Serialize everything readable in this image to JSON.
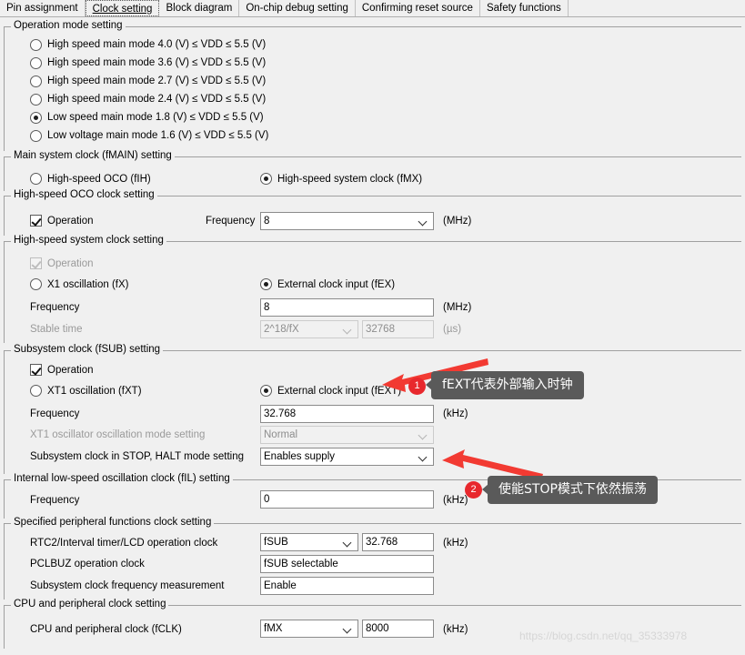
{
  "tabs": [
    {
      "label": "Pin assignment",
      "active": false
    },
    {
      "label": "Clock setting",
      "active": true
    },
    {
      "label": "Block diagram",
      "active": false
    },
    {
      "label": "On-chip debug setting",
      "active": false
    },
    {
      "label": "Confirming reset source",
      "active": false
    },
    {
      "label": "Safety functions",
      "active": false
    }
  ],
  "groups": {
    "operation_mode": {
      "title": "Operation mode setting",
      "options": [
        {
          "label": "High speed main mode 4.0 (V) ≤ VDD ≤ 5.5 (V)",
          "selected": false
        },
        {
          "label": "High speed main mode 3.6 (V) ≤ VDD ≤ 5.5 (V)",
          "selected": false
        },
        {
          "label": "High speed main mode 2.7 (V) ≤ VDD ≤ 5.5 (V)",
          "selected": false
        },
        {
          "label": "High speed main mode 2.4 (V) ≤ VDD ≤ 5.5 (V)",
          "selected": false
        },
        {
          "label": "Low speed main mode 1.8 (V) ≤ VDD ≤ 5.5 (V)",
          "selected": true
        },
        {
          "label": "Low voltage main mode 1.6 (V) ≤ VDD ≤ 5.5 (V)",
          "selected": false
        }
      ]
    },
    "main_system_clock": {
      "title": "Main system clock (fMAIN) setting",
      "option_fih": "High-speed OCO (fIH)",
      "option_fmx": "High-speed system clock (fMX)"
    },
    "hs_oco": {
      "title": "High-speed OCO clock setting",
      "operation_label": "Operation",
      "frequency_label": "Frequency",
      "frequency_value": "8",
      "unit": "(MHz)"
    },
    "hs_system": {
      "title": "High-speed system clock setting",
      "operation_label": "Operation",
      "option_fx": "X1 oscillation (fX)",
      "option_fex": "External clock input (fEX)",
      "frequency_label": "Frequency",
      "frequency_value": "8",
      "frequency_unit": "(MHz)",
      "stable_time_label": "Stable time",
      "stable_time_value": "2^18/fX",
      "stable_time_number": "32768",
      "stable_time_unit": "(µs)"
    },
    "subsystem": {
      "title": "Subsystem clock (fSUB) setting",
      "operation_label": "Operation",
      "option_fxt": "XT1 oscillation (fXT)",
      "option_fext": "External clock input (fEXT)",
      "frequency_label": "Frequency",
      "frequency_value": "32.768",
      "frequency_unit": "(kHz)",
      "xt1_mode_label": "XT1 oscillator oscillation mode setting",
      "xt1_mode_value": "Normal",
      "stop_halt_label": "Subsystem clock in STOP, HALT mode setting",
      "stop_halt_value": "Enables supply"
    },
    "internal_low_speed": {
      "title": "Internal low-speed oscillation clock (fIL) setting",
      "frequency_label": "Frequency",
      "frequency_value": "0",
      "frequency_unit": "(kHz)"
    },
    "peripheral": {
      "title": "Specified peripheral functions clock setting",
      "rtc_label": "RTC2/Interval timer/LCD operation clock",
      "rtc_value": "fSUB",
      "rtc_number": "32.768",
      "rtc_unit": "(kHz)",
      "pclbuz_label": "PCLBUZ operation clock",
      "pclbuz_value": "fSUB selectable",
      "measurement_label": "Subsystem clock frequency measurement",
      "measurement_value": "Enable"
    },
    "cpu": {
      "title": "CPU and peripheral clock setting",
      "fclk_label": "CPU and peripheral clock (fCLK)",
      "fclk_value": "fMX",
      "fclk_number": "8000",
      "fclk_unit": "(kHz)"
    }
  },
  "annotations": [
    {
      "number": "1",
      "text": "fEXT代表外部输入时钟"
    },
    {
      "number": "2",
      "text": "使能STOP模式下依然振荡"
    }
  ],
  "watermark": "https://blog.csdn.net/qq_35333978",
  "colors": {
    "accent_red": "#e8282d",
    "bubble_gray": "#5a5a5a",
    "background": "#f0f0f0"
  }
}
